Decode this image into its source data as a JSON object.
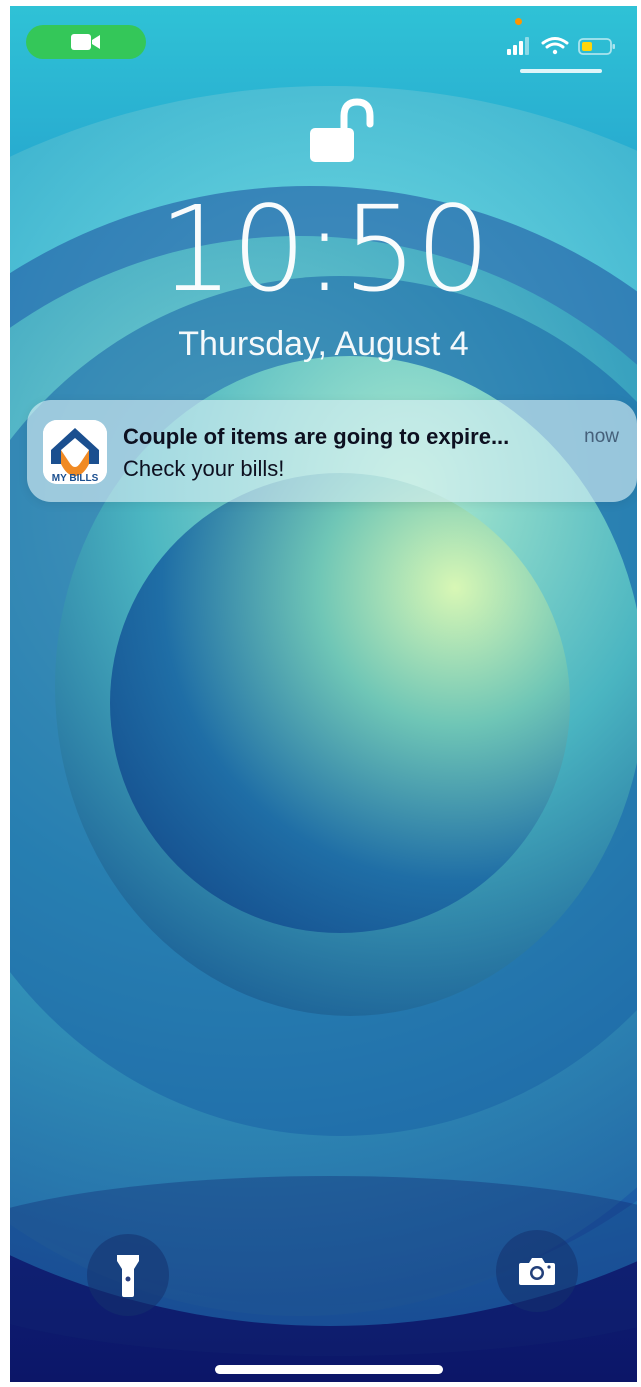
{
  "status_bar": {
    "call_icon": "video-camera-icon",
    "call_pill_color": "#34c759",
    "signal_icon": "cellular-signal-icon",
    "wifi_icon": "wifi-icon",
    "battery_icon": "battery-icon",
    "battery_color": "#ffd60a",
    "privacy_dot_color": "#ff9500"
  },
  "lock_screen": {
    "lock_icon": "unlocked-padlock-icon",
    "time": "10:50",
    "date": "Thursday, August 4"
  },
  "notification": {
    "app_icon": "my-bills-app-icon",
    "app_icon_text": "MY BILLS",
    "title": "Couple of items are going to expire...",
    "time": "now",
    "body": "Check your bills!"
  },
  "bottom_controls": {
    "flashlight_icon": "flashlight-icon",
    "camera_icon": "camera-icon"
  }
}
